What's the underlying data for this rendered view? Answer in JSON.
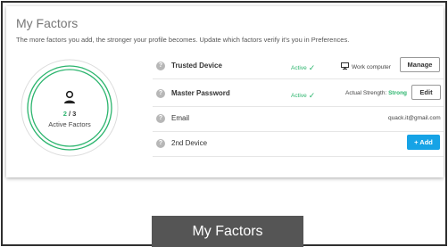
{
  "panel": {
    "title": "My Factors",
    "subtitle": "The more factors you add, the stronger your profile becomes. Update which factors verify it's you in Preferences."
  },
  "gauge": {
    "active": "2",
    "separator": " / ",
    "total": "3",
    "label": "Active Factors",
    "progress": 0.667,
    "color": "#2cb56e"
  },
  "factors": [
    {
      "name": "Trusted Device",
      "status": "Active",
      "detail": "Work computer",
      "detail_icon": "monitor-icon",
      "button": "Manage"
    },
    {
      "name": "Master Password",
      "status": "Active",
      "detail_prefix": "Actual Strength: ",
      "detail_strength": "Strong",
      "button": "Edit"
    },
    {
      "name": "Email",
      "detail": "quack.it@gmail.com"
    },
    {
      "name": "2nd Device",
      "button": "+ Add"
    }
  ],
  "help_icon_glyph": "?",
  "caption": "My Factors",
  "colors": {
    "accent_green": "#2cb56e",
    "accent_blue": "#16a3e6",
    "caption_bg": "#555555"
  }
}
